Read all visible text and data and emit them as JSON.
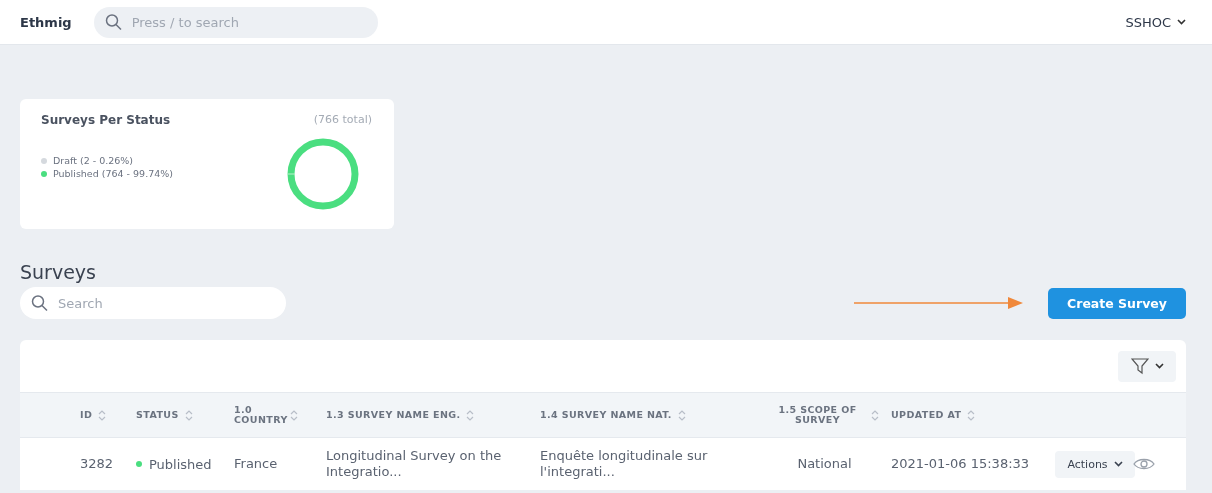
{
  "header": {
    "brand": "Ethmig",
    "search": {
      "placeholder": "Press / to search"
    },
    "account": "SSHOC"
  },
  "status_card": {
    "title": "Surveys Per Status",
    "total": "(766 total)",
    "legend": [
      {
        "label": "Draft (2 - 0.26%)",
        "color": "#d5d9de"
      },
      {
        "label": "Published (764 - 99.74%)",
        "color": "#4ade80"
      }
    ]
  },
  "surveys": {
    "title": "Surveys",
    "search": {
      "placeholder": "Search"
    },
    "create_button": "Create Survey",
    "columns": [
      "ID",
      "STATUS",
      "1.0 COUNTRY",
      "1.3 SURVEY NAME ENG.",
      "1.4 SURVEY NAME NAT.",
      "1.5 SCOPE OF SURVEY",
      "UPDATED AT"
    ],
    "rows": [
      {
        "id": "3282",
        "status": "Published",
        "color": "#4ade80",
        "country": "France",
        "name_eng": "Longitudinal Survey on the Integratio...",
        "name_nat": "Enquête longitudinale sur l'integrati...",
        "scope": "National",
        "updated": "2021-01-06 15:38:33",
        "actions": "Actions"
      }
    ]
  }
}
